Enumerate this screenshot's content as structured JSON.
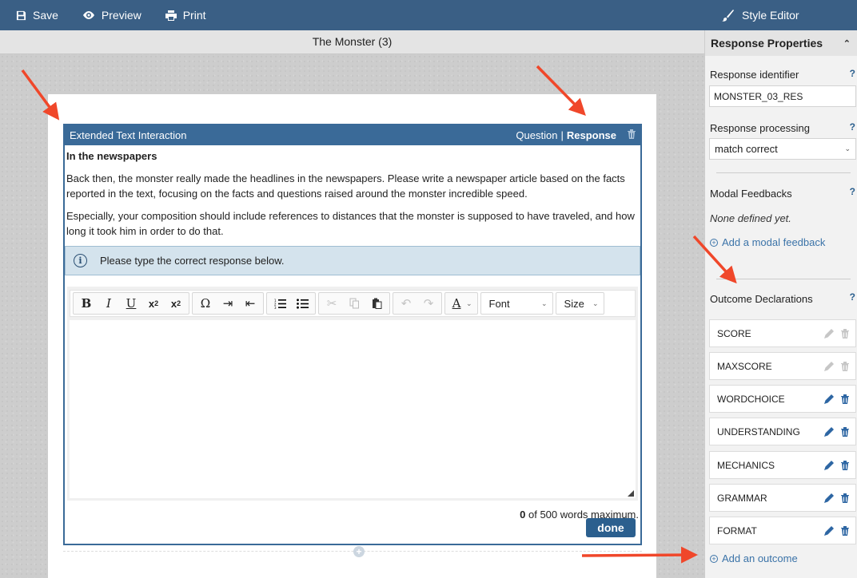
{
  "toolbar": {
    "save": "Save",
    "preview": "Preview",
    "print": "Print"
  },
  "style_editor": "Style Editor",
  "item_title": "The Monster (3)",
  "interaction": {
    "title": "Extended Text Interaction",
    "tab_question": "Question",
    "separator": "|",
    "tab_response": "Response",
    "prompt_heading": "In the newspapers",
    "prompt_p1": "Back then, the monster really made the headlines in the newspapers. Please write a newspaper article based on the facts reported in the text, focusing on the facts and questions raised around the monster incredible speed.",
    "prompt_p2": "Especially, your composition should include references to distances that the monster is supposed to have traveled, and how long it took him in order to do that.",
    "info_text": "Please type the correct response below.",
    "font_label": "Font",
    "size_label": "Size",
    "word_count": "0",
    "word_count_suffix": "of 500 words maximum.",
    "done": "done"
  },
  "panel": {
    "section_title": "Response Properties",
    "response_identifier_label": "Response identifier",
    "response_identifier_value": "MONSTER_03_RES",
    "response_processing_label": "Response processing",
    "response_processing_value": "match correct",
    "modal_feedbacks_label": "Modal Feedbacks",
    "modal_none": "None defined yet.",
    "add_modal": "Add a modal feedback",
    "outcome_label": "Outcome Declarations",
    "help": "?",
    "outcomes": [
      {
        "name": "SCORE",
        "editable": false
      },
      {
        "name": "MAXSCORE",
        "editable": false
      },
      {
        "name": "WORDCHOICE",
        "editable": true
      },
      {
        "name": "UNDERSTANDING",
        "editable": true
      },
      {
        "name": "MECHANICS",
        "editable": true
      },
      {
        "name": "GRAMMAR",
        "editable": true
      },
      {
        "name": "FORMAT",
        "editable": true
      }
    ],
    "add_outcome": "Add an outcome"
  },
  "colors": {
    "header": "#3a5f85",
    "interaction_header": "#3a6a98",
    "annotation_arrow": "#f0472a",
    "link": "#3b73a8"
  }
}
